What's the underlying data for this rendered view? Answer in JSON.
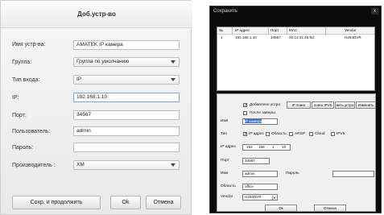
{
  "left": {
    "title": "Доб.устр-во",
    "fields": {
      "device_name": {
        "label": "Имя устр-ва:",
        "value": "AMATEK IP камера"
      },
      "group": {
        "label": "Группа:",
        "value": "Группа по умолчанию"
      },
      "input_type": {
        "label": "Тип входа:",
        "value": "IP"
      },
      "ip": {
        "label": "IP:",
        "value": "192.168.1.10"
      },
      "port": {
        "label": "Порт:",
        "value": "34567"
      },
      "users": {
        "label": "Пользователь:",
        "value": "admin"
      },
      "passwords": {
        "label": "Пароль:",
        "value": ""
      },
      "manufacturer": {
        "label": "Производитель :",
        "value": "XM"
      }
    },
    "buttons": {
      "save_continue": "Сохр. и продолжить",
      "ok": "Ok",
      "cancel": "Отмена"
    }
  },
  "right": {
    "title": "Сохранить",
    "close": "x",
    "list": {
      "headers": [
        "№",
        "IP адрес",
        "Порт",
        "MAC",
        "Vendor"
      ],
      "rows": [
        [
          "1",
          "192.168.1.10",
          "34567",
          "00:12:31:45:9d:",
          "H264DVR"
        ]
      ]
    },
    "panel": {
      "added_device": "Добавлено устро",
      "after_search": "После заверш",
      "buttons": {
        "ip_search": "IP поиск",
        "ipv6_search": "поиск IPV6",
        "delete_device": "вить устро",
        "change": "Изменить"
      },
      "name": {
        "label": "Имя",
        "value": "IP камера"
      },
      "type": {
        "label": "Тип",
        "options": [
          "IP адрес",
          "Область",
          "ARSP",
          "Cloud",
          "IPV6"
        ],
        "checked": "IP адрес"
      },
      "ip": {
        "label": "IP адрес",
        "octets": [
          "192",
          "168",
          "1",
          "10"
        ]
      },
      "port": {
        "label": "Порт",
        "value": "34567"
      },
      "user": {
        "label": "Имя",
        "value": "admin"
      },
      "password": {
        "label": "Пароль",
        "value": ""
      },
      "area": {
        "label": "Область",
        "value": "office"
      },
      "vendor": {
        "label": "Vendor",
        "value": "H264DVR"
      },
      "ok": "Ок",
      "cancel": "Отмена"
    }
  }
}
